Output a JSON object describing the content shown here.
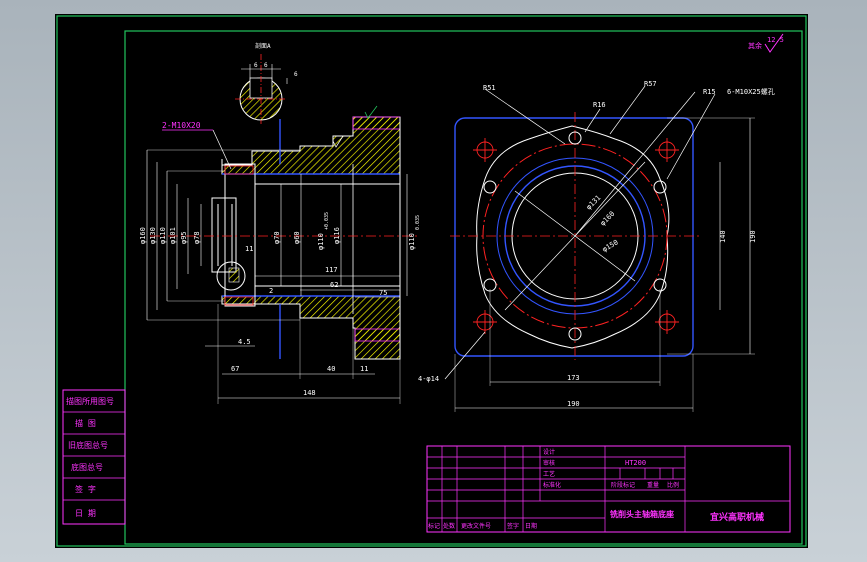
{
  "drawing": {
    "roughness": {
      "symbol_label": "其余",
      "value": "12.5"
    },
    "section_label": "剖面A",
    "keyway": {
      "dim_w1": "6",
      "dim_w2": "6",
      "dim_h": "6"
    },
    "side_view": {
      "thread_callout": "2-M10X20",
      "diameters": [
        "φ160",
        "φ130",
        "φ110",
        "φ101",
        "φ95",
        "φ78",
        "φ70",
        "φ60",
        "φ110",
        "φ116",
        "φ110"
      ],
      "tol_upper": "+0.035",
      "tol_lower": "0",
      "tol_right": "0.035",
      "slot_width": "11",
      "small_dim": "2",
      "dim_117": "117",
      "dim_62": "62",
      "dim_75": "75",
      "dim_45": "4.5",
      "dim_67": "67",
      "dim_40": "40",
      "dim_11": "11",
      "dim_148": "148"
    },
    "front_view": {
      "radius_r51": "R51",
      "radius_r57": "R57",
      "radius_r16": "R16",
      "radius_r15": "R15",
      "screw_callout": "6-M10X25螺孔",
      "dia_131": "φ131",
      "dia_160": "φ160",
      "dia_150": "φ150",
      "hole_callout": "4-φ14",
      "dim_140": "140",
      "dim_190_v": "190",
      "dim_173": "173",
      "dim_190_h": "190"
    }
  },
  "side_table": {
    "rows": [
      "描图所用图号",
      "描  图",
      "旧底图总号",
      "底图总号",
      "签  字",
      "日  期"
    ]
  },
  "title_block": {
    "change_labels": [
      "设计",
      "审核",
      "工艺",
      "标准化"
    ],
    "material": "HT200",
    "stage_label": "阶段标记",
    "weight_label": "重量",
    "scale_label": "比例",
    "drawing_name": "铣削头主轴箱底座",
    "school": "宜兴高职机械",
    "bottom_labels": [
      "标记",
      "处数",
      "更改文件号",
      "签字",
      "日期"
    ]
  }
}
